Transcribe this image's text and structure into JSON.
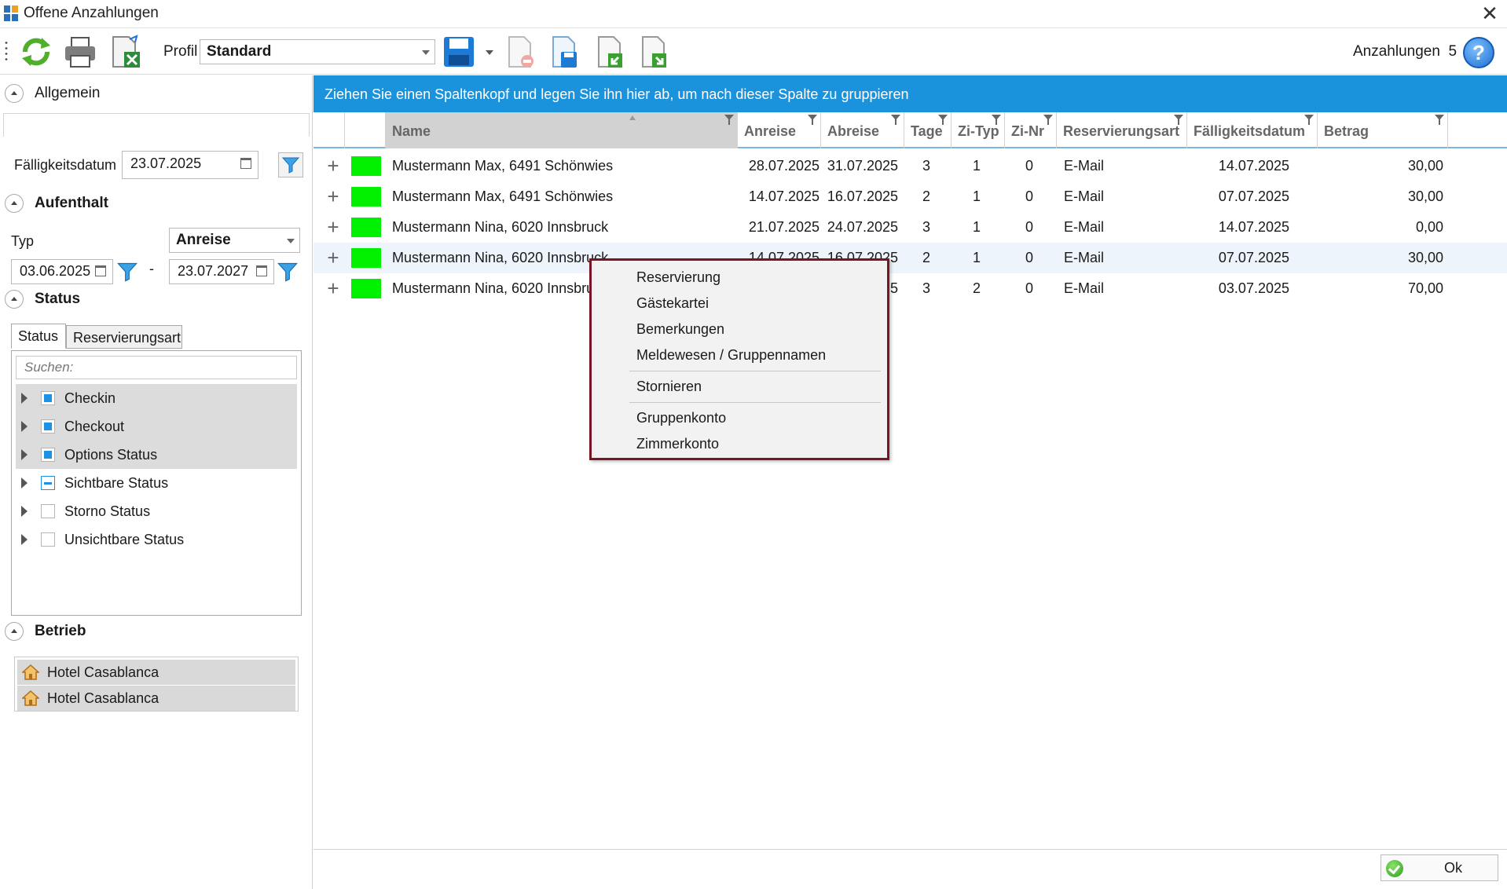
{
  "window": {
    "title": "Offene Anzahlungen"
  },
  "toolbar": {
    "profil_label": "Profil",
    "profil_value": "Standard",
    "anzahlungen_label": "Anzahlungen",
    "anzahlungen_count": "5",
    "help_label": "?"
  },
  "left": {
    "allgemein": {
      "title": "Allgemein"
    },
    "faelligkeit": {
      "label": "Fälligkeitsdatum",
      "value": "23.07.2025"
    },
    "aufenthalt": {
      "title": "Aufenthalt",
      "typ_label": "Typ",
      "typ_value": "Anreise",
      "from": "03.06.2025",
      "dash": "-",
      "to": "23.07.2027"
    },
    "status": {
      "title": "Status",
      "tabs": [
        "Status",
        "Reservierungsart"
      ],
      "search_placeholder": "Suchen:",
      "items": [
        {
          "label": "Checkin",
          "check": "full",
          "selected": true
        },
        {
          "label": "Checkout",
          "check": "full",
          "selected": true
        },
        {
          "label": "Options Status",
          "check": "full",
          "selected": true
        },
        {
          "label": "Sichtbare Status",
          "check": "partial",
          "selected": false
        },
        {
          "label": "Storno Status",
          "check": "none",
          "selected": false
        },
        {
          "label": "Unsichtbare Status",
          "check": "none",
          "selected": false
        }
      ]
    },
    "betrieb": {
      "title": "Betrieb",
      "items": [
        "Hotel Casablanca",
        "Hotel Casablanca"
      ]
    }
  },
  "grid": {
    "group_hint": "Ziehen Sie einen Spaltenkopf und legen Sie ihn hier ab, um nach dieser Spalte zu gruppieren",
    "columns": [
      "Name",
      "Anreise",
      "Abreise",
      "Tage",
      "Zi-Typ",
      "Zi-Nr",
      "Reservierungsart",
      "Fälligkeitsdatum",
      "Betrag"
    ],
    "rows": [
      {
        "name": "Mustermann Max, 6491 Schönwies",
        "anreise": "28.07.2025",
        "abreise": "31.07.2025",
        "tage": "3",
        "zityp": "1",
        "zinr": "0",
        "resart": "E-Mail",
        "faellig": "14.07.2025",
        "betrag": "30,00"
      },
      {
        "name": "Mustermann Max, 6491 Schönwies",
        "anreise": "14.07.2025",
        "abreise": "16.07.2025",
        "tage": "2",
        "zityp": "1",
        "zinr": "0",
        "resart": "E-Mail",
        "faellig": "07.07.2025",
        "betrag": "30,00"
      },
      {
        "name": "Mustermann Nina, 6020 Innsbruck",
        "anreise": "21.07.2025",
        "abreise": "24.07.2025",
        "tage": "3",
        "zityp": "1",
        "zinr": "0",
        "resart": "E-Mail",
        "faellig": "14.07.2025",
        "betrag": "0,00"
      },
      {
        "name": "Mustermann Nina, 6020 Innsbruck",
        "anreise": "14.07.2025",
        "abreise": "16.07.2025",
        "tage": "2",
        "zityp": "1",
        "zinr": "0",
        "resart": "E-Mail",
        "faellig": "07.07.2025",
        "betrag": "30,00"
      },
      {
        "name": "Mustermann Nina, 6020 Innsbruck",
        "anreise": "",
        "abreise": "5",
        "tage": "3",
        "zityp": "2",
        "zinr": "0",
        "resart": "E-Mail",
        "faellig": "03.07.2025",
        "betrag": "70,00"
      }
    ],
    "row_color": "#00f000"
  },
  "context_menu": {
    "group1": [
      "Reservierung",
      "Gästekartei",
      "Bemerkungen",
      "Meldewesen / Gruppennamen"
    ],
    "group2": [
      "Stornieren"
    ],
    "group3": [
      "Gruppenkonto",
      "Zimmerkonto"
    ]
  },
  "footer": {
    "ok_label": "Ok"
  },
  "colors": {
    "accent": "#1a93dc",
    "context_border": "#7a1523",
    "selection": "#dcdcdc"
  }
}
